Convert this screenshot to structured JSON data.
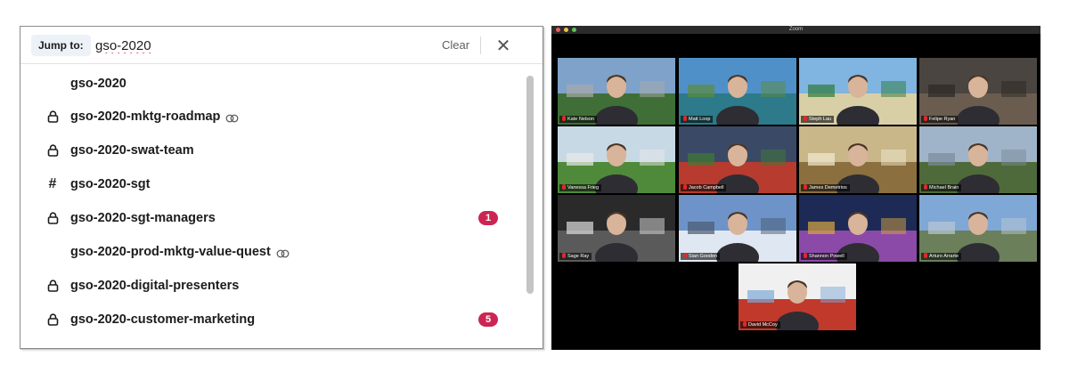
{
  "slack": {
    "jump_label": "Jump to:",
    "search_value": "gso-2020",
    "clear_label": "Clear",
    "results": [
      {
        "label": "gso-2020",
        "icon": "none",
        "shared": false,
        "badge": ""
      },
      {
        "label": "gso-2020-mktg-roadmap",
        "icon": "lock-icon",
        "shared": true,
        "badge": ""
      },
      {
        "label": "gso-2020-swat-team",
        "icon": "lock-icon",
        "shared": false,
        "badge": ""
      },
      {
        "label": "gso-2020-sgt",
        "icon": "hash-icon",
        "shared": false,
        "badge": ""
      },
      {
        "label": "gso-2020-sgt-managers",
        "icon": "lock-icon",
        "shared": false,
        "badge": "1"
      },
      {
        "label": "gso-2020-prod-mktg-value-quest",
        "icon": "none",
        "shared": true,
        "badge": ""
      },
      {
        "label": "gso-2020-digital-presenters",
        "icon": "lock-icon",
        "shared": false,
        "badge": ""
      },
      {
        "label": "gso-2020-customer-marketing",
        "icon": "lock-icon",
        "shared": false,
        "badge": "5"
      }
    ],
    "colors": {
      "badge": "#cd2553",
      "jump_label_bg": "#ecf2f7",
      "text": "#1d1c1d"
    }
  },
  "zoom": {
    "window_title": "Zoom",
    "participants": [
      {
        "name": "Kate Nelson",
        "bg": "stadium",
        "active": false
      },
      {
        "name": "Matt Loop",
        "bg": "coast",
        "active": false
      },
      {
        "name": "Steph Lau",
        "bg": "beach",
        "active": false
      },
      {
        "name": "Felipe Ryan",
        "bg": "room",
        "active": true
      },
      {
        "name": "Vanessa Frieg",
        "bg": "golf",
        "active": false
      },
      {
        "name": "Jacob Campbell",
        "bg": "arena",
        "active": false
      },
      {
        "name": "James Demetrios",
        "bg": "oval-office",
        "active": false
      },
      {
        "name": "Michael Brain",
        "bg": "cliffs",
        "active": false
      },
      {
        "name": "Sage Ray",
        "bg": "boxing-ring",
        "active": false
      },
      {
        "name": "Sian Gooden",
        "bg": "mountains",
        "active": false
      },
      {
        "name": "Shannon Powell",
        "bg": "las-vegas",
        "active": false
      },
      {
        "name": "Arturo Arrarte",
        "bg": "cape-town",
        "active": false
      },
      {
        "name": "David McCoy",
        "bg": "golden-gate",
        "active": false
      }
    ],
    "colors": {
      "active_speaker": "#d9e34a",
      "muted_mic": "#e02828"
    }
  }
}
